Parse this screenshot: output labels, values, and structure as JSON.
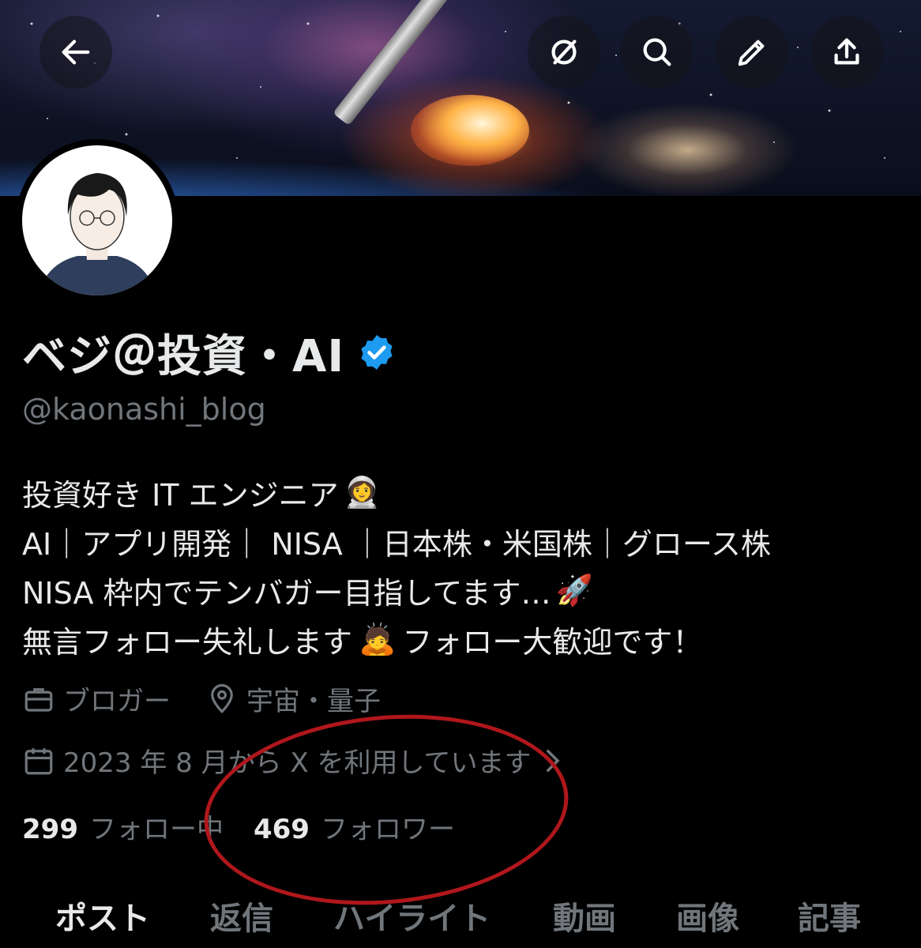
{
  "header": {
    "back_icon": "arrow-left-icon",
    "grok_icon": "grok-icon",
    "search_icon": "search-icon",
    "edit_icon": "pencil-icon",
    "share_icon": "share-icon"
  },
  "profile": {
    "display_name": "ベジ＠投資・AI",
    "handle": "@kaonashi_blog",
    "verified_color": "#1d9bf0",
    "bio": [
      "投資好き IT エンジニア",
      "AI｜アプリ開発｜ NISA ｜日本株・米国株｜グロース株",
      "NISA 枠内でテンバガー目指してます…",
      "無言フォロー失礼します",
      "フォロー大歓迎です！"
    ],
    "bio_emojis": [
      "👩‍🚀",
      "🚀",
      "🙇"
    ],
    "profession": "ブロガー",
    "location": "宇宙・量子",
    "joined": "2023 年 8 月から X を利用しています"
  },
  "stats": {
    "following_count": "299",
    "following_label": "フォロー中",
    "followers_count": "469",
    "followers_label": "フォロワー"
  },
  "tabs": [
    {
      "label": "ポスト",
      "active": true
    },
    {
      "label": "返信",
      "active": false
    },
    {
      "label": "ハイライト",
      "active": false
    },
    {
      "label": "動画",
      "active": false
    },
    {
      "label": "画像",
      "active": false
    },
    {
      "label": "記事",
      "active": false
    }
  ],
  "annotation_color": "#b0171c"
}
